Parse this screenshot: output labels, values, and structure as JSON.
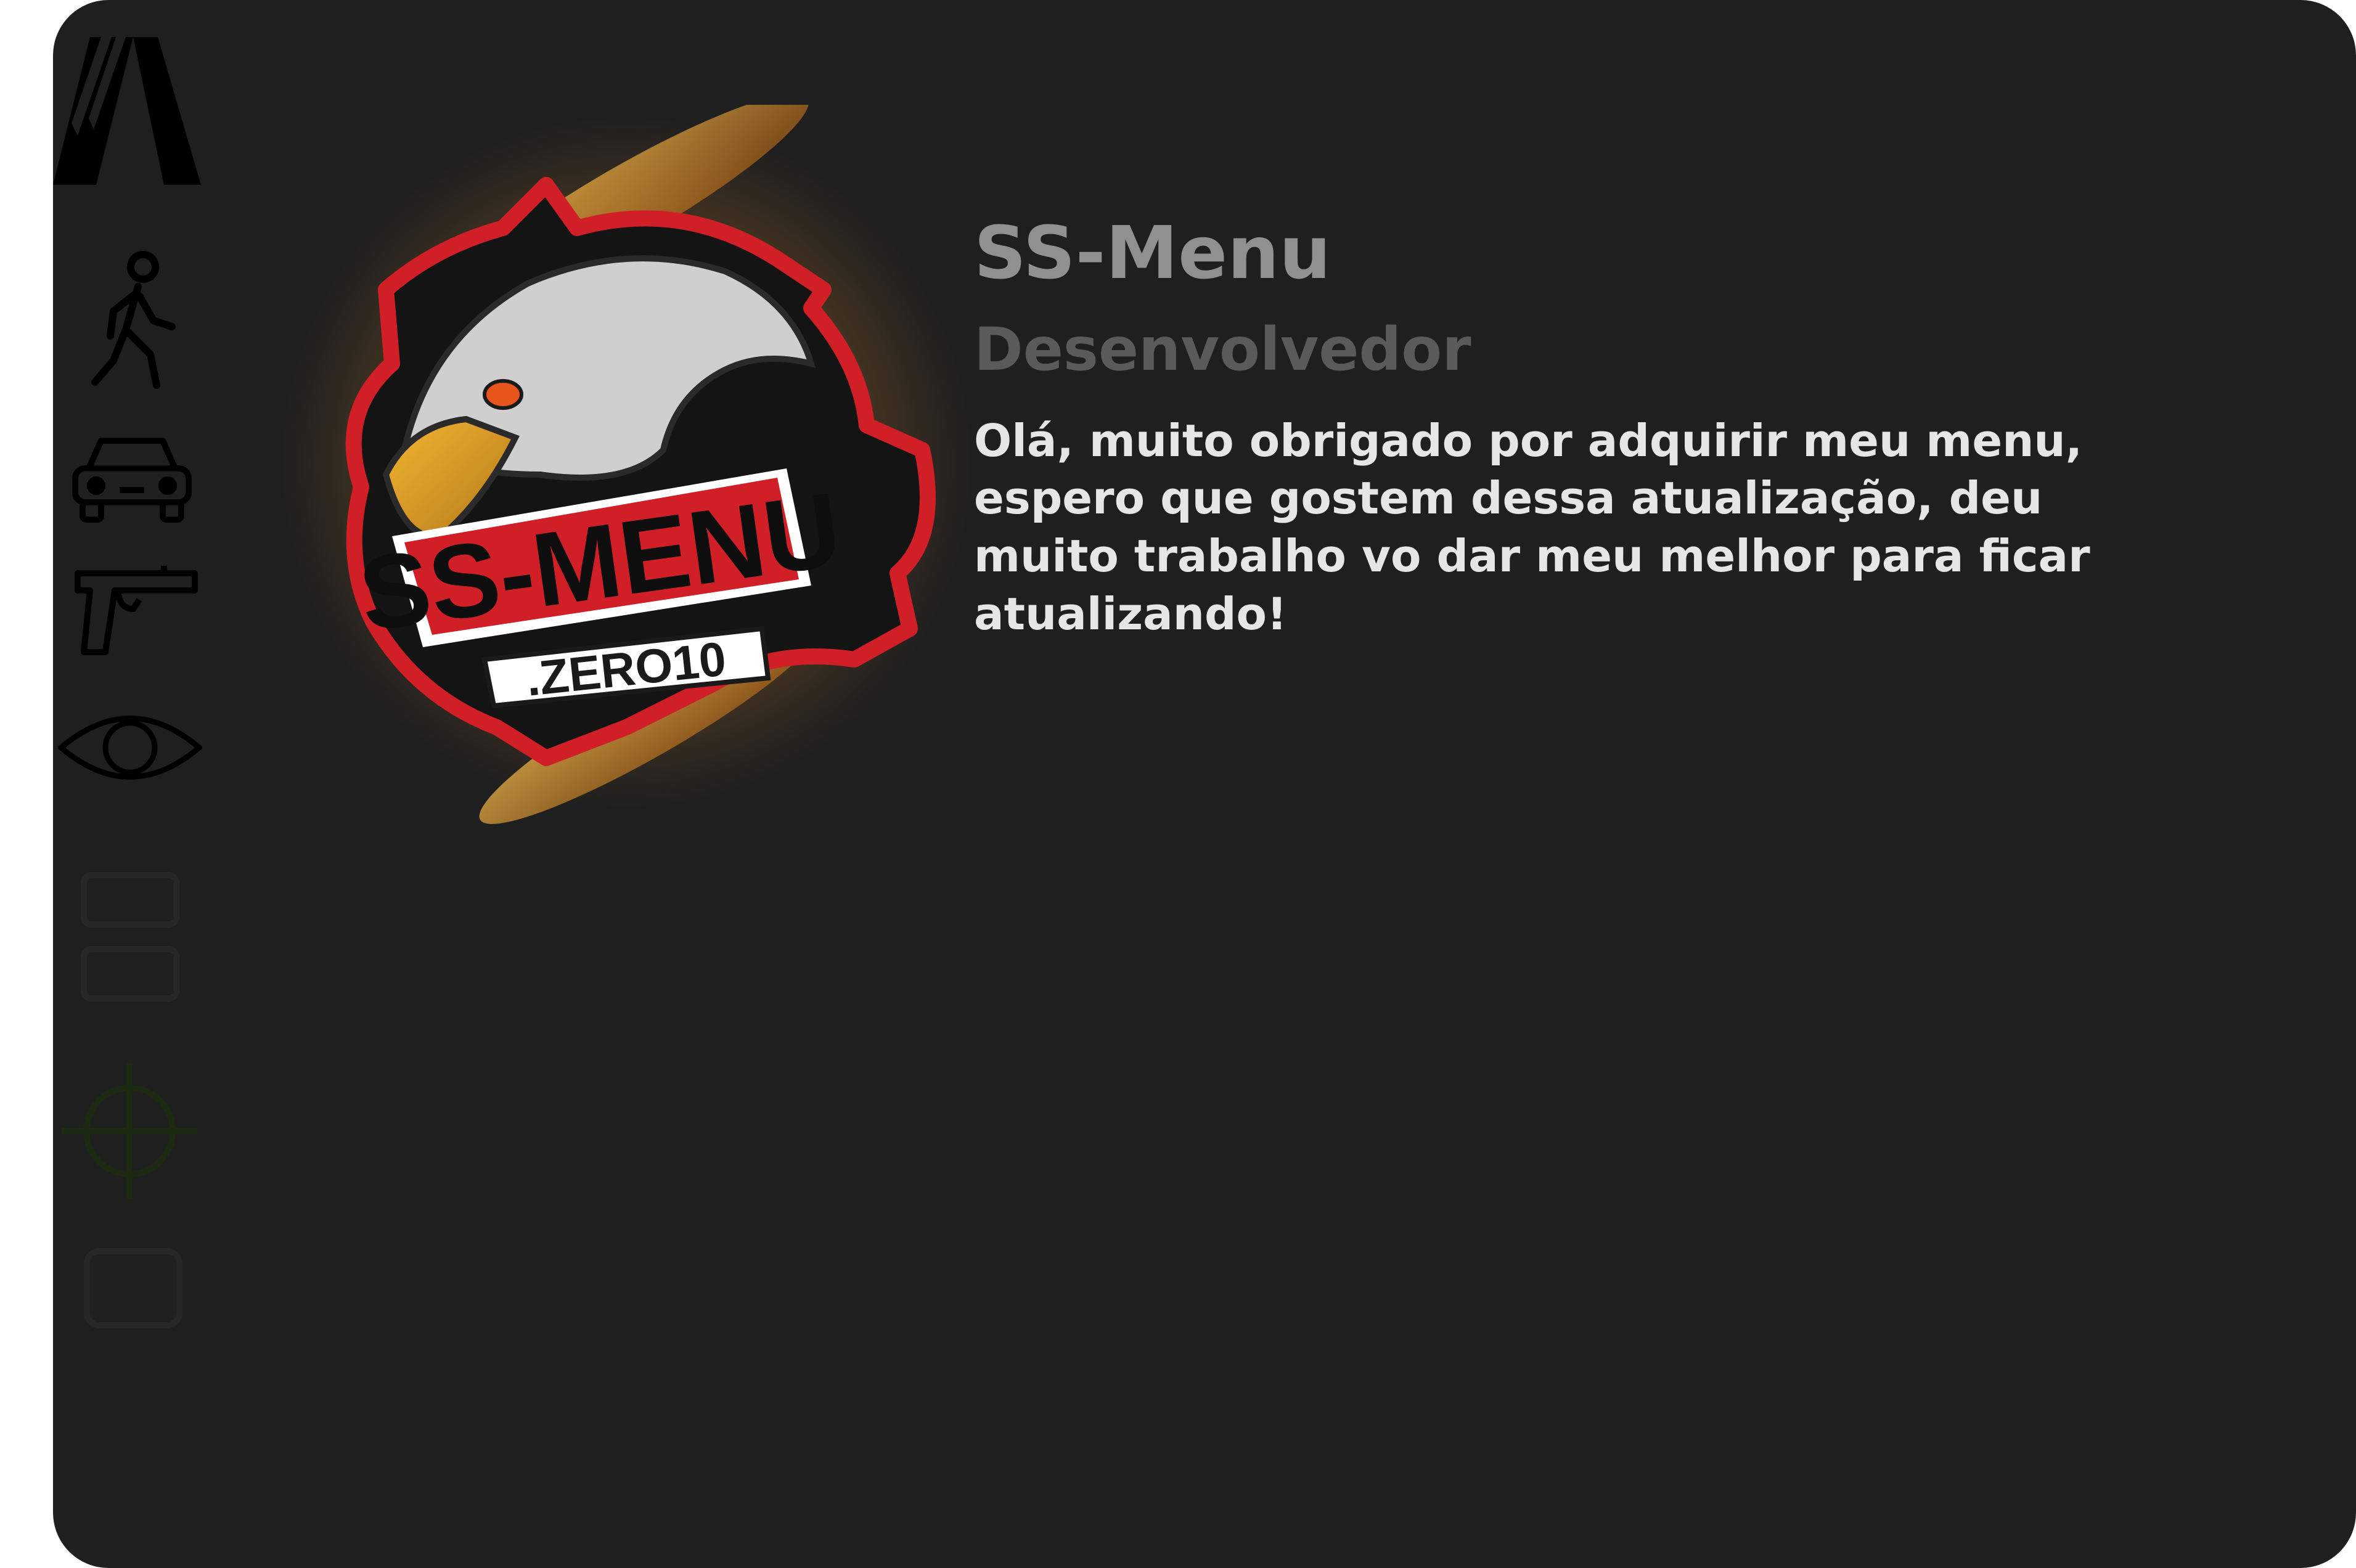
{
  "sidebar": {
    "items": [
      {
        "icon": "fivem-logo-icon"
      },
      {
        "icon": "player-walking-icon"
      },
      {
        "icon": "vehicle-car-icon"
      },
      {
        "icon": "weapon-pistol-icon"
      },
      {
        "icon": "visuals-eye-icon"
      },
      {
        "icon": "faded-menu-icon"
      },
      {
        "icon": "aimbot-crosshair-icon"
      },
      {
        "icon": "faded-settings-icon"
      }
    ]
  },
  "logo": {
    "main_text": "SS-MENU",
    "sub_text": ".ZERO10"
  },
  "content": {
    "title": "SS-Menu",
    "subtitle": "Desenvolvedor",
    "description": "Olá, muito obrigado por adquirir meu menu, espero que gostem dessa atualização, deu muito trabalho vo dar meu melhor para ficar atualizando!"
  },
  "colors": {
    "panel_bg": "#1f1f1f",
    "title": "#909090",
    "subtitle": "#5a5a5a",
    "description": "#e6e6e6",
    "logo_red": "#d01f27",
    "crosshair": "#1d2a12"
  }
}
